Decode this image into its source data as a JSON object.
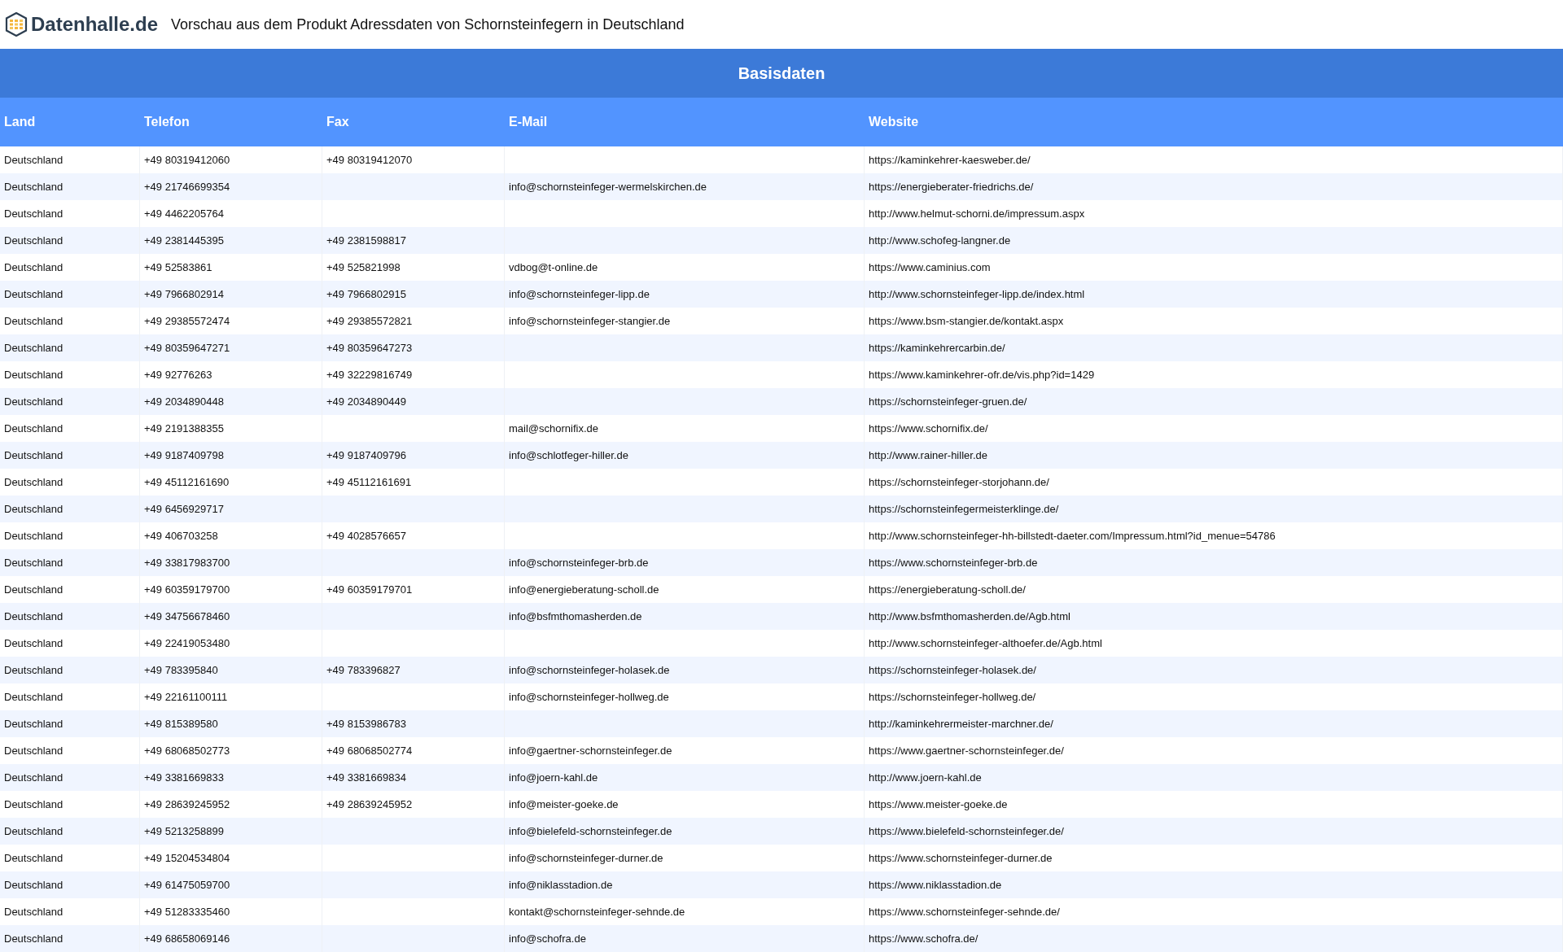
{
  "header": {
    "logo_text": "Datenhalle.de",
    "title": "Vorschau aus dem Produkt Adressdaten von Schornsteinfegern in Deutschland"
  },
  "table": {
    "group_title": "Basisdaten",
    "columns": [
      "Land",
      "Telefon",
      "Fax",
      "E-Mail",
      "Website"
    ],
    "rows": [
      {
        "land": "Deutschland",
        "telefon": "+49 80319412060",
        "fax": "+49 80319412070",
        "website": "https://kaminkehrer-kaesweber.de/"
      },
      {
        "land": "Deutschland",
        "telefon": "+49 21746699354",
        "email": "info@schornsteinfeger-wermelskirchen.de",
        "website": "https://energieberater-friedrichs.de/"
      },
      {
        "land": "Deutschland",
        "telefon": "+49 4462205764",
        "website": "http://www.helmut-schorni.de/impressum.aspx"
      },
      {
        "land": "Deutschland",
        "telefon": "+49 2381445395",
        "fax": "+49 2381598817",
        "website": "http://www.schofeg-langner.de"
      },
      {
        "land": "Deutschland",
        "telefon": "+49 52583861",
        "fax": "+49 525821998",
        "email": "vdbog@t-online.de",
        "website": "https://www.caminius.com"
      },
      {
        "land": "Deutschland",
        "telefon": "+49 7966802914",
        "fax": "+49 7966802915",
        "email": "info@schornsteinfeger-lipp.de",
        "website": "http://www.schornsteinfeger-lipp.de/index.html"
      },
      {
        "land": "Deutschland",
        "telefon": "+49 29385572474",
        "fax": "+49 29385572821",
        "email": "info@schornsteinfeger-stangier.de",
        "website": "https://www.bsm-stangier.de/kontakt.aspx"
      },
      {
        "land": "Deutschland",
        "telefon": "+49 80359647271",
        "fax": "+49 80359647273",
        "website": "https://kaminkehrercarbin.de/"
      },
      {
        "land": "Deutschland",
        "telefon": "+49 92776263",
        "fax": "+49 32229816749",
        "website": "https://www.kaminkehrer-ofr.de/vis.php?id=1429"
      },
      {
        "land": "Deutschland",
        "telefon": "+49 2034890448",
        "fax": "+49 2034890449",
        "website": "https://schornsteinfeger-gruen.de/"
      },
      {
        "land": "Deutschland",
        "telefon": "+49 2191388355",
        "email": "mail@schornifix.de",
        "website": "https://www.schornifix.de/"
      },
      {
        "land": "Deutschland",
        "telefon": "+49 9187409798",
        "fax": "+49 9187409796",
        "email": "info@schlotfeger-hiller.de",
        "website": "http://www.rainer-hiller.de"
      },
      {
        "land": "Deutschland",
        "telefon": "+49 45112161690",
        "fax": "+49 45112161691",
        "website": "https://schornsteinfeger-storjohann.de/"
      },
      {
        "land": "Deutschland",
        "telefon": "+49 6456929717",
        "website": "https://schornsteinfegermeisterklinge.de/"
      },
      {
        "land": "Deutschland",
        "telefon": "+49 406703258",
        "fax": "+49 4028576657",
        "website": "http://www.schornsteinfeger-hh-billstedt-daeter.com/Impressum.html?id_menue=54786"
      },
      {
        "land": "Deutschland",
        "telefon": "+49 33817983700",
        "email": "info@schornsteinfeger-brb.de",
        "website": "https://www.schornsteinfeger-brb.de"
      },
      {
        "land": "Deutschland",
        "telefon": "+49 60359179700",
        "fax": "+49 60359179701",
        "email": "info@energieberatung-scholl.de",
        "website": "https://energieberatung-scholl.de/"
      },
      {
        "land": "Deutschland",
        "telefon": "+49 34756678460",
        "email": "info@bsfmthomasherden.de",
        "website": "http://www.bsfmthomasherden.de/Agb.html"
      },
      {
        "land": "Deutschland",
        "telefon": "+49 22419053480",
        "website": "http://www.schornsteinfeger-althoefer.de/Agb.html"
      },
      {
        "land": "Deutschland",
        "telefon": "+49 783395840",
        "fax": "+49 783396827",
        "email": "info@schornsteinfeger-holasek.de",
        "website": "https://schornsteinfeger-holasek.de/"
      },
      {
        "land": "Deutschland",
        "telefon": "+49 22161100111",
        "email": "info@schornsteinfeger-hollweg.de",
        "website": "https://schornsteinfeger-hollweg.de/"
      },
      {
        "land": "Deutschland",
        "telefon": "+49 815389580",
        "fax": "+49 8153986783",
        "website": "http://kaminkehrermeister-marchner.de/"
      },
      {
        "land": "Deutschland",
        "telefon": "+49 68068502773",
        "fax": "+49 68068502774",
        "email": "info@gaertner-schornsteinfeger.de",
        "website": "https://www.gaertner-schornsteinfeger.de/"
      },
      {
        "land": "Deutschland",
        "telefon": "+49 3381669833",
        "fax": "+49 3381669834",
        "email": "info@joern-kahl.de",
        "website": "http://www.joern-kahl.de"
      },
      {
        "land": "Deutschland",
        "telefon": "+49 28639245952",
        "fax": "+49 28639245952",
        "email": "info@meister-goeke.de",
        "website": "https://www.meister-goeke.de"
      },
      {
        "land": "Deutschland",
        "telefon": "+49 5213258899",
        "email": "info@bielefeld-schornsteinfeger.de",
        "website": "https://www.bielefeld-schornsteinfeger.de/"
      },
      {
        "land": "Deutschland",
        "telefon": "+49 15204534804",
        "email": "info@schornsteinfeger-durner.de",
        "website": "https://www.schornsteinfeger-durner.de"
      },
      {
        "land": "Deutschland",
        "telefon": "+49 61475059700",
        "email": "info@niklasstadion.de",
        "website": "https://www.niklasstadion.de"
      },
      {
        "land": "Deutschland",
        "telefon": "+49 51283335460",
        "email": "kontakt@schornsteinfeger-sehnde.de",
        "website": "https://www.schornsteinfeger-sehnde.de/"
      },
      {
        "land": "Deutschland",
        "telefon": "+49 68658069146",
        "email": "info@schofra.de",
        "website": "https://www.schofra.de/"
      }
    ]
  }
}
